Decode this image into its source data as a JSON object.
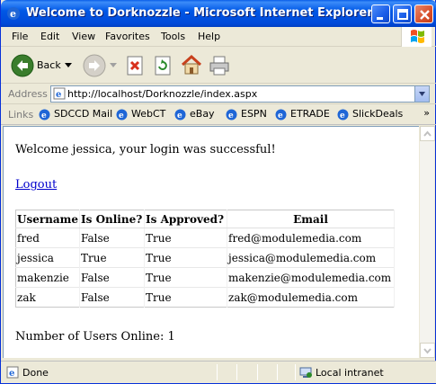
{
  "window": {
    "title": "Welcome to Dorknozzle - Microsoft Internet Explorer"
  },
  "menu": {
    "items": [
      "File",
      "Edit",
      "View",
      "Favorites",
      "Tools",
      "Help"
    ]
  },
  "toolbar": {
    "back_label": "Back"
  },
  "address": {
    "label": "Address",
    "url": "http://localhost/Dorknozzle/index.aspx"
  },
  "links": {
    "label": "Links",
    "items": [
      "SDCCD Mail",
      "WebCT",
      "eBay",
      "ESPN",
      "ETRADE",
      "SlickDeals"
    ]
  },
  "page": {
    "welcome": "Welcome jessica, your login was successful!",
    "logout": "Logout",
    "table": {
      "headers": [
        "Username",
        "Is Online?",
        "Is Approved?",
        "Email"
      ],
      "rows": [
        [
          "fred",
          "False",
          "True",
          "fred@modulemedia.com"
        ],
        [
          "jessica",
          "True",
          "True",
          "jessica@modulemedia.com"
        ],
        [
          "makenzie",
          "False",
          "True",
          "makenzie@modulemedia.com"
        ],
        [
          "zak",
          "False",
          "True",
          "zak@modulemedia.com"
        ]
      ]
    },
    "users_online": "Number of Users Online: 1"
  },
  "status": {
    "text": "Done",
    "zone": "Local intranet"
  }
}
